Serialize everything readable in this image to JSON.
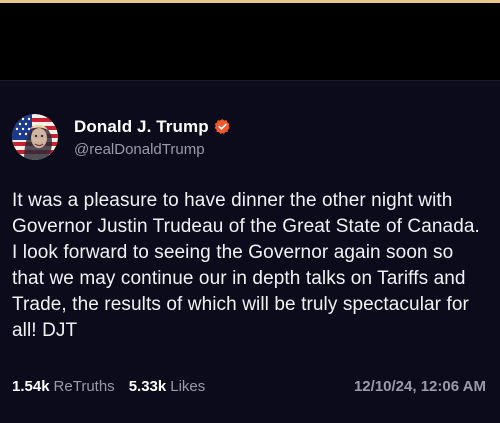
{
  "post": {
    "author": {
      "display_name": "Donald J. Trump",
      "handle": "@realDonaldTrump",
      "verified_icon": "verified-badge-icon",
      "verified_color": "#f0572b",
      "avatar": "profile-avatar"
    },
    "text": "It was a pleasure to have dinner the other night with Governor Justin Trudeau of the Great State of Canada. I look forward to seeing the Governor again soon so that we may continue our in depth talks on Tariffs and Trade, the results of which will be truly spectacular for all! DJT",
    "stats": {
      "retruths_count": "1.54k",
      "retruths_label": "ReTruths",
      "likes_count": "5.33k",
      "likes_label": "Likes"
    },
    "timestamp": "12/10/24, 12:06 AM"
  },
  "colors": {
    "background": "#000000",
    "card": "#0b0b1b",
    "accent_bar": "#e8c98a",
    "primary_text": "#ffffff",
    "secondary_text": "#9a9aa8"
  }
}
